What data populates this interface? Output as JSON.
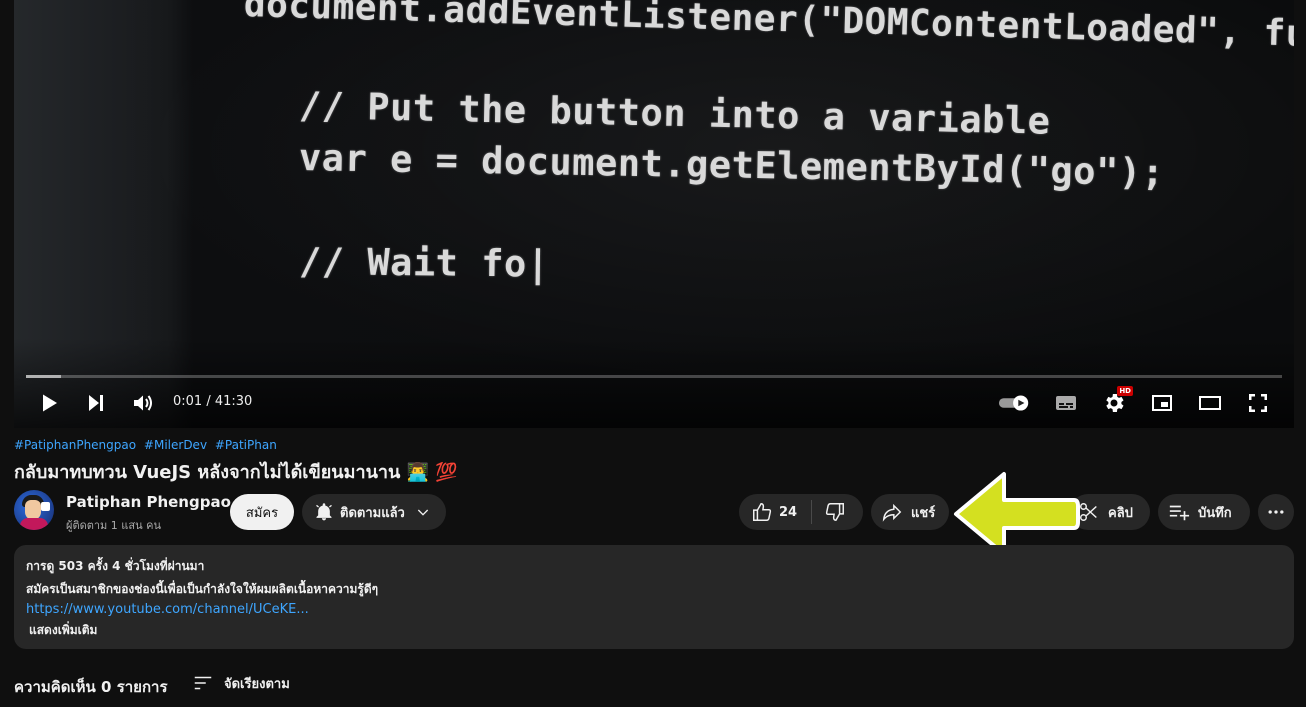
{
  "video": {
    "code_lines": [
      "document.addEventListener(\"DOMContentLoaded\", function",
      "// Put the button into a variable",
      "var e = document.getElementById(\"go\");",
      "// Wait fo|"
    ],
    "time_display": "0:01 / 41:30",
    "progress_fraction": 0.028,
    "hd_badge": "HD",
    "icons": {
      "play": "play-icon",
      "next": "next-icon",
      "volume": "volume-icon",
      "autoplay": "autoplay-toggle-icon",
      "captions": "captions-icon",
      "settings": "gear-icon",
      "miniplayer": "miniplayer-icon",
      "theater": "theater-mode-icon",
      "fullscreen": "fullscreen-icon"
    }
  },
  "info": {
    "hashtags": [
      "#PatiphanPhengpao",
      "#MilerDev",
      "#PatiPhan"
    ],
    "title": "กลับมาทบทวน VueJS หลังจากไม่ได้เขียนมานาน 👨‍💻 💯",
    "channel_name": "Patiphan Phengpao",
    "subscriber_count": "ผู้ติดตาม 1 แสน คน",
    "subscribe_label": "สมัคร",
    "subscribed_label": "ติดตามแล้ว",
    "like_count": "24",
    "share_label": "แชร์",
    "clip_label": "คลิป",
    "save_label": "บันทึก"
  },
  "description": {
    "stats": "การดู 503 ครั้ง  4 ชั่วโมงที่ผ่านมา",
    "text": "สมัครเป็นสมาชิกของช่องนี้เพื่อเป็นกำลังใจให้ผมผลิตเนื้อหาความรู้ดีๆ",
    "link": "https://www.youtube.com/channel/UCeKE...",
    "show_more": "แสดงเพิ่มเติม"
  },
  "comments": {
    "count_label": "ความคิดเห็น 0 รายการ",
    "sort_label": "จัดเรียงตาม"
  },
  "colors": {
    "background": "#0f0f0f",
    "pill": "#272727",
    "link": "#3ea6ff",
    "annotation_arrow": "#d4e020"
  }
}
